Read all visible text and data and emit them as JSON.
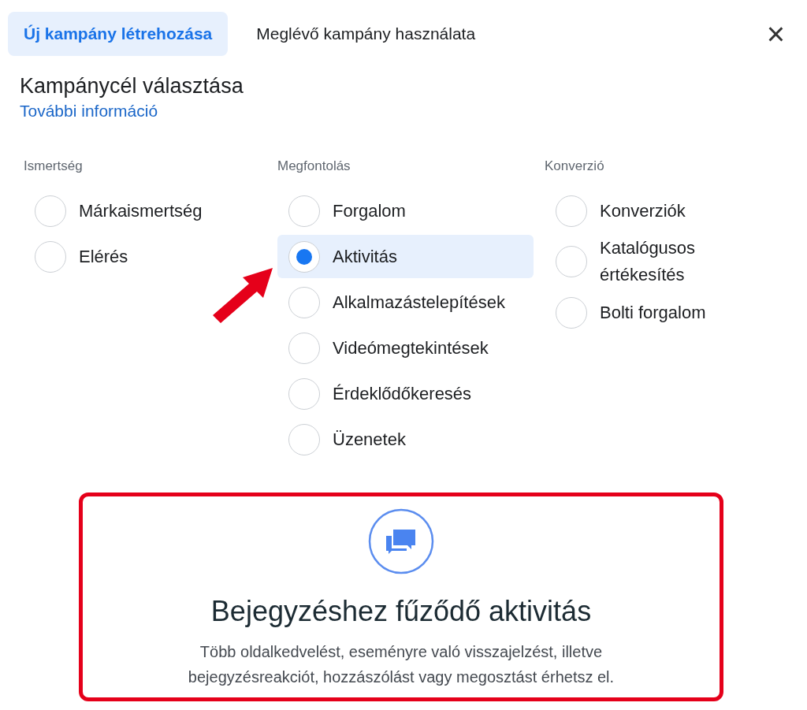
{
  "tabs": [
    {
      "label": "Új kampány létrehozása",
      "selected": true
    },
    {
      "label": "Meglévő kampány használata",
      "selected": false
    }
  ],
  "close_button": "×",
  "heading": "Kampánycél választása",
  "more_info_link": "További információ",
  "objective_groups": [
    {
      "title": "Ismertség",
      "options": [
        {
          "label": "Márkaismertség",
          "selected": false
        },
        {
          "label": "Elérés",
          "selected": false
        }
      ]
    },
    {
      "title": "Megfontolás",
      "options": [
        {
          "label": "Forgalom",
          "selected": false
        },
        {
          "label": "Aktivitás",
          "selected": true
        },
        {
          "label": "Alkalmazástelepítések",
          "selected": false
        },
        {
          "label": "Videómegtekintések",
          "selected": false
        },
        {
          "label": "Érdeklődőkeresés",
          "selected": false
        },
        {
          "label": "Üzenetek",
          "selected": false
        }
      ]
    },
    {
      "title": "Konverzió",
      "options": [
        {
          "label": "Konverziók",
          "selected": false
        },
        {
          "label": "Katalógusos értékesítés",
          "selected": false
        },
        {
          "label": "Bolti forgalom",
          "selected": false
        }
      ]
    }
  ],
  "objective_detail": {
    "title": "Bejegyzéshez fűződő aktivitás",
    "description_lines": [
      "Több oldalkedvelést, eseményre való visszajelzést, illetve",
      "bejegyzésreakciót, hozzászólást vagy megosztást érhetsz el."
    ]
  }
}
